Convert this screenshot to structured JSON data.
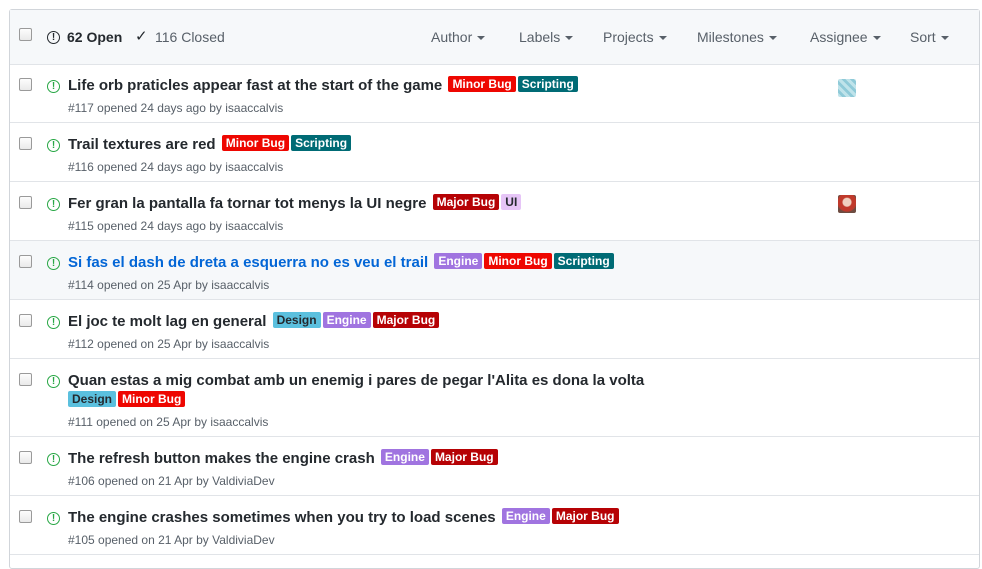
{
  "header": {
    "open_count": "62 Open",
    "closed_count": "116 Closed",
    "filters": [
      "Author",
      "Labels",
      "Projects",
      "Milestones",
      "Assignee",
      "Sort"
    ]
  },
  "colors": {
    "Minor Bug": "#ee0701",
    "Major Bug": "#b60205",
    "Scripting": "#006b75",
    "Engine": "#a074e0",
    "Design": "#5bc0de",
    "UI": "#e6c5f7",
    "open_icon": "#28a745",
    "link": "#0366d6"
  },
  "issues": [
    {
      "title": "Life orb praticles appear fast at the start of the game",
      "labels": [
        "Minor Bug",
        "Scripting"
      ],
      "meta": "#117 opened 24 days ago by isaaccalvis",
      "assignee_icon": "identicon-avatar-icon"
    },
    {
      "title": "Trail textures are red",
      "labels": [
        "Minor Bug",
        "Scripting"
      ],
      "meta": "#116 opened 24 days ago by isaaccalvis"
    },
    {
      "title": "Fer gran la pantalla fa tornar tot menys la UI negre",
      "labels": [
        "Major Bug",
        "UI"
      ],
      "meta": "#115 opened 24 days ago by isaaccalvis",
      "assignee_icon": "user-avatar-icon"
    },
    {
      "title": "Si fas el dash de dreta a esquerra no es veu el trail",
      "labels": [
        "Engine",
        "Minor Bug",
        "Scripting"
      ],
      "meta": "#114 opened on 25 Apr by isaaccalvis"
    },
    {
      "title": "El joc te molt lag en general",
      "labels": [
        "Design",
        "Engine",
        "Major Bug"
      ],
      "meta": "#112 opened on 25 Apr by isaaccalvis"
    },
    {
      "title": "Quan estas a mig combat amb un enemig i pares de pegar l'Alita es dona la volta",
      "labels": [
        "Design",
        "Minor Bug"
      ],
      "meta": "#111 opened on 25 Apr by isaaccalvis"
    },
    {
      "title": "The refresh button makes the engine crash",
      "labels": [
        "Engine",
        "Major Bug"
      ],
      "meta": "#106 opened on 21 Apr by ValdiviaDev"
    },
    {
      "title": "The engine crashes sometimes when you try to load scenes",
      "labels": [
        "Engine",
        "Major Bug"
      ],
      "meta": "#105 opened on 21 Apr by ValdiviaDev"
    }
  ]
}
